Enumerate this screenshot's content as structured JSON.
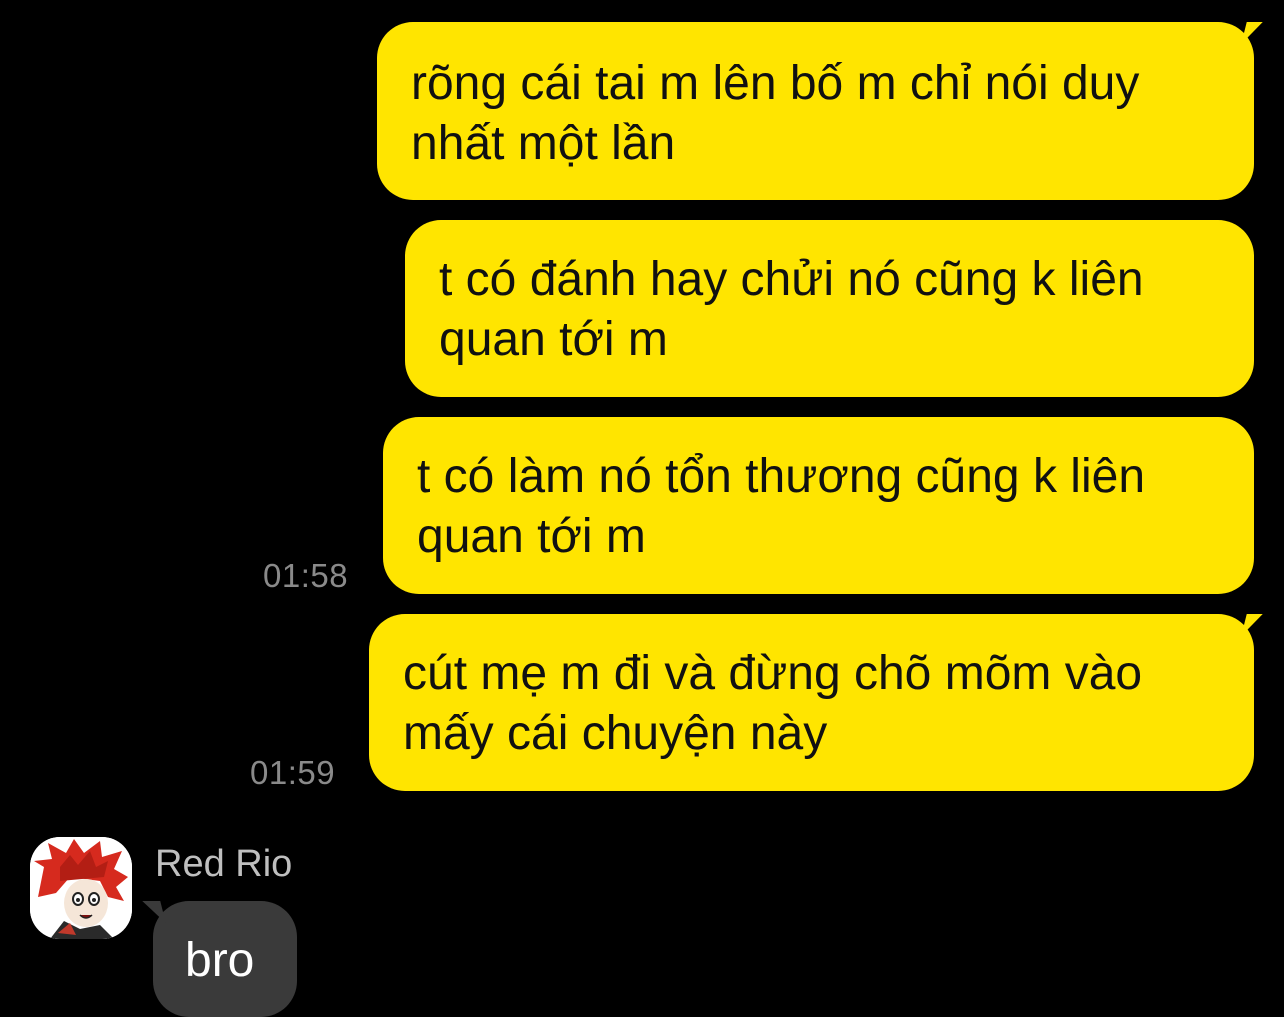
{
  "messages": {
    "m1": "rõng cái tai m lên bố m chỉ nói duy\nnhất một lần",
    "m2": "t có đánh hay chửi nó cũng k liên\nquan tới m",
    "m3": "t có làm nó tổn thương cũng k liên\nquan tới m",
    "m4": "cút mẹ m đi và đừng chõ mõm vào\nmấy cái chuyện này",
    "reply": "bro"
  },
  "timestamps": {
    "t1": "01:58",
    "t2": "01:59"
  },
  "sender": {
    "name": "Red Rio",
    "avatar_icon": "anime-avatar-icon"
  },
  "colors": {
    "outgoing_bubble": "#FFE500",
    "incoming_bubble": "#3A3A3A",
    "background": "#000000"
  }
}
